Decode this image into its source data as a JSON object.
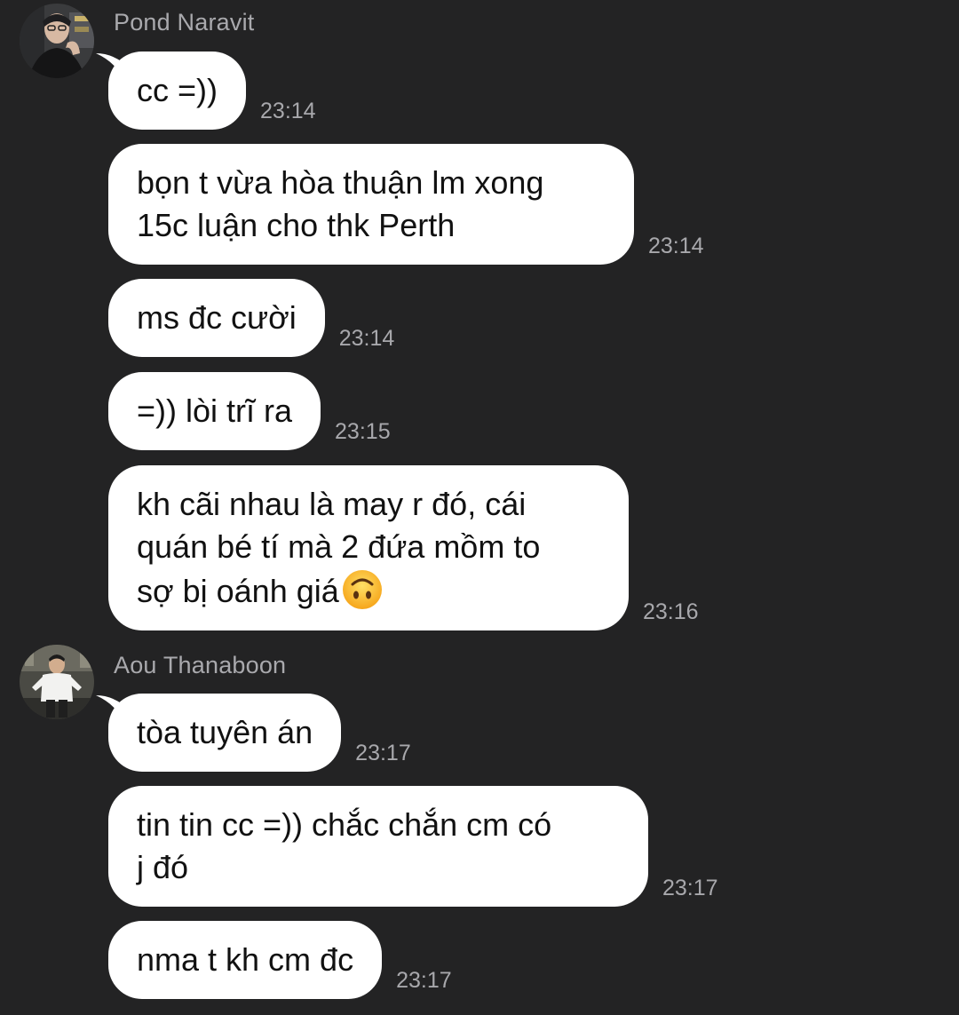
{
  "conversation": {
    "groups": [
      {
        "sender": "Pond Naravit",
        "avatar_icon": "profile-photo-pond",
        "messages": [
          {
            "text": "cc =))",
            "time": "23:14"
          },
          {
            "text": "bọn t vừa hòa thuận lm xong\n15c luận cho thk Perth",
            "time": "23:14"
          },
          {
            "text": "ms đc cười",
            "time": "23:14"
          },
          {
            "text": "=)) lòi trĩ ra",
            "time": "23:15"
          },
          {
            "text": "kh cãi nhau là may r đó, cái\nquán bé tí mà 2 đứa mồm to\nsợ bị oánh giá",
            "emoji": "upside-down-face-icon",
            "time": "23:16"
          }
        ]
      },
      {
        "sender": "Aou Thanaboon",
        "avatar_icon": "profile-photo-aou",
        "messages": [
          {
            "text": "tòa tuyên án",
            "time": "23:17"
          },
          {
            "text": "tin tin cc =)) chắc chắn cm có\nj đó",
            "time": "23:17"
          },
          {
            "text": "nma t kh cm đc",
            "time": "23:17"
          }
        ]
      }
    ]
  },
  "colors": {
    "background": "#232324",
    "bubble": "#ffffff",
    "bubble_text": "#111111",
    "meta_text": "#a8a8ac"
  }
}
